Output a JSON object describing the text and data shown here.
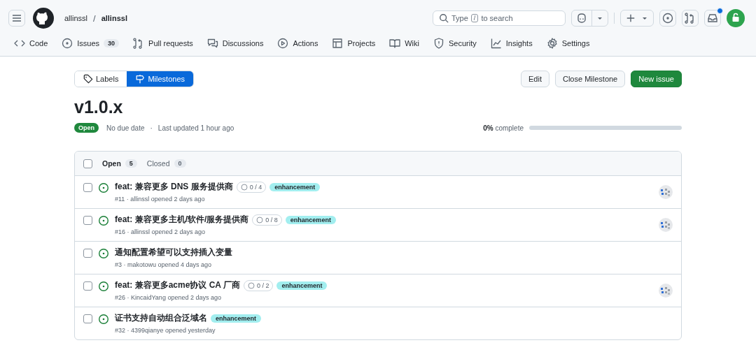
{
  "header": {
    "owner": "allinssl",
    "separator": "/",
    "repo": "allinssl",
    "search": {
      "prefix": "Type",
      "key": "/",
      "suffix": "to search"
    },
    "notification_dot": true
  },
  "repo_nav": [
    {
      "kind": "code",
      "label": "Code"
    },
    {
      "kind": "issues",
      "label": "Issues",
      "count": "30"
    },
    {
      "kind": "pulls",
      "label": "Pull requests"
    },
    {
      "kind": "discussions",
      "label": "Discussions"
    },
    {
      "kind": "actions",
      "label": "Actions"
    },
    {
      "kind": "projects",
      "label": "Projects"
    },
    {
      "kind": "wiki",
      "label": "Wiki"
    },
    {
      "kind": "security",
      "label": "Security"
    },
    {
      "kind": "insights",
      "label": "Insights"
    },
    {
      "kind": "settings",
      "label": "Settings"
    }
  ],
  "subnav": [
    {
      "kind": "labels",
      "label": "Labels",
      "selected": false
    },
    {
      "kind": "milestones",
      "label": "Milestones",
      "selected": true
    }
  ],
  "actions": [
    {
      "kind": "default",
      "label": "Edit"
    },
    {
      "kind": "default",
      "label": "Close Milestone"
    },
    {
      "kind": "primary",
      "label": "New issue"
    }
  ],
  "milestone": {
    "title": "v1.0.x",
    "state": "Open",
    "due": "No due date",
    "separator": "·",
    "updated": "Last updated 1 hour ago",
    "percent": "0%",
    "percent_word": "complete",
    "level": 0
  },
  "list": {
    "select_all": false,
    "filters": [
      {
        "label": "Open",
        "count": "5",
        "selected": true
      },
      {
        "label": "Closed",
        "count": "0",
        "selected": false
      }
    ],
    "issues": [
      {
        "title": "feat: 兼容更多 DNS 服务提供商",
        "tasks": {
          "text": "0 / 4",
          "level": 0
        },
        "labels": [
          {
            "name": "enhancement",
            "color": "#a2eeef"
          }
        ],
        "meta": "#11 · allinssl opened 2 days ago",
        "assignee": true,
        "checked": false
      },
      {
        "title": "feat: 兼容更多主机/软件/服务提供商",
        "tasks": {
          "text": "0 / 8",
          "level": 0
        },
        "labels": [
          {
            "name": "enhancement",
            "color": "#a2eeef"
          }
        ],
        "meta": "#16 · allinssl opened 2 days ago",
        "assignee": true,
        "checked": false
      },
      {
        "title": "通知配置希望可以支持插入变量",
        "meta": "#3 · makotowu opened 4 days ago",
        "assignee": false,
        "checked": false
      },
      {
        "title": "feat: 兼容更多acme协议 CA 厂商",
        "tasks": {
          "text": "0 / 2",
          "level": 0
        },
        "labels": [
          {
            "name": "enhancement",
            "color": "#a2eeef"
          }
        ],
        "meta": "#26 · KincaidYang opened 2 days ago",
        "assignee": true,
        "checked": false
      },
      {
        "title": "证书支持自动组合泛域名",
        "labels": [
          {
            "name": "enhancement",
            "color": "#a2eeef"
          }
        ],
        "meta": "#32 · 4399qianye opened yesterday",
        "assignee": false,
        "checked": false
      }
    ]
  }
}
